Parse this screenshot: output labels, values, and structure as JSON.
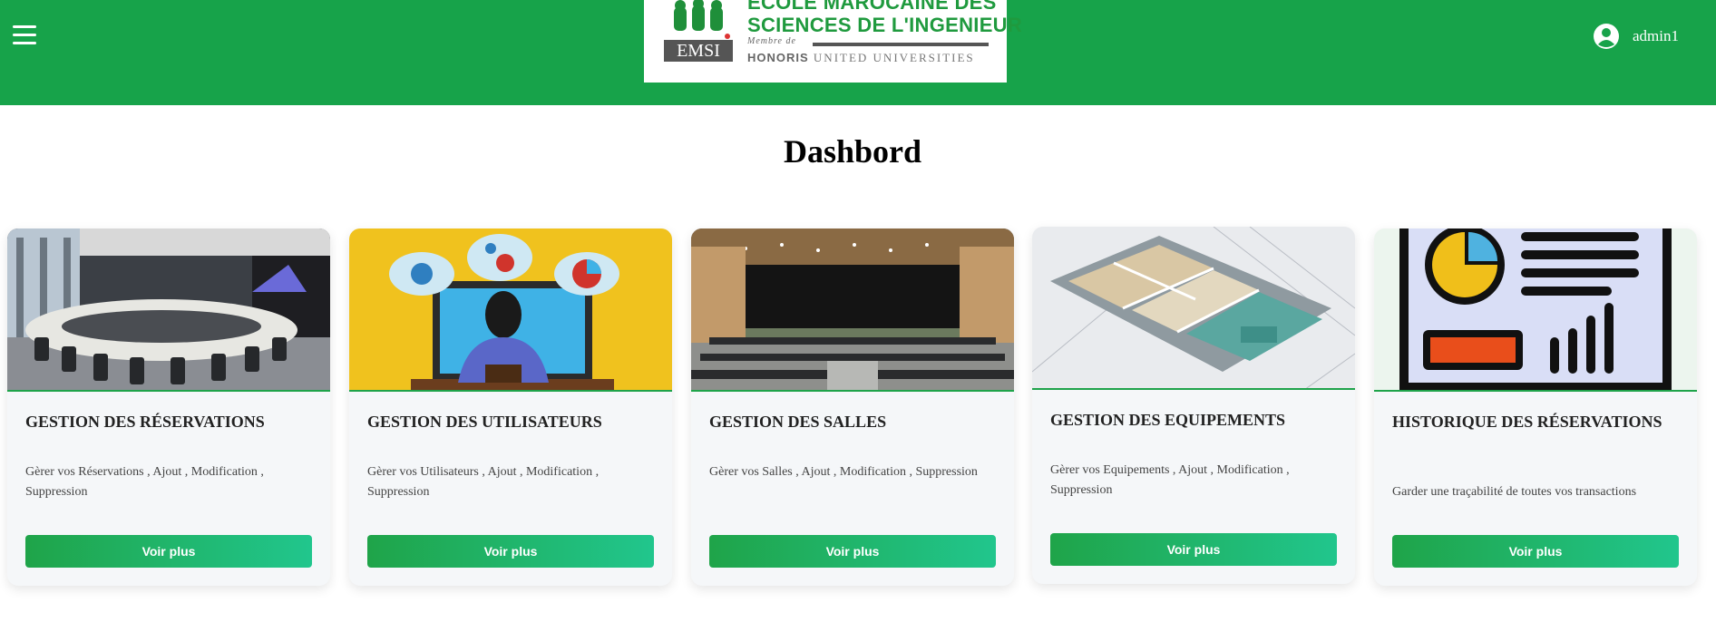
{
  "header": {
    "menu_icon": "hamburger-menu-icon",
    "logo": {
      "line1": "ÉCOLE MAROCAINE DES",
      "line2": "SCIENCES DE L'INGENIEUR",
      "badge": "EMSI",
      "membre": "Membre de",
      "honoris": "HONORIS",
      "universities": "UNITED UNIVERSITIES"
    },
    "user": {
      "icon": "user-circle-icon",
      "name": "admin1"
    },
    "colors": {
      "bar": "#17a34a",
      "logo_green": "#1f9a3e"
    }
  },
  "page": {
    "title": "Dashbord"
  },
  "cards": [
    {
      "title": "GESTION DES RÉSERVATIONS",
      "description": "Gèrer vos Réservations , Ajout , Modification , Suppression",
      "button": "Voir plus",
      "image": "conference-room-photo"
    },
    {
      "title": "GESTION DES UTILISATEURS",
      "description": "Gèrer vos Utilisateurs , Ajout , Modification , Suppression",
      "button": "Voir plus",
      "image": "user-at-computer-illustration"
    },
    {
      "title": "GESTION DES SALLES",
      "description": "Gèrer vos Salles , Ajout , Modification , Suppression",
      "button": "Voir plus",
      "image": "auditorium-hall-photo"
    },
    {
      "title": "GESTION DES EQUIPEMENTS",
      "description": "Gèrer vos Equipements , Ajout , Modification , Suppression",
      "button": "Voir plus",
      "image": "3d-floor-plan-photo"
    },
    {
      "title": "HISTORIQUE DES RÉSERVATIONS",
      "description": "Garder une traçabilité de toutes vos transactions",
      "button": "Voir plus",
      "image": "report-chart-illustration"
    }
  ],
  "button_gradient": [
    "#1fa449",
    "#21c68d"
  ]
}
